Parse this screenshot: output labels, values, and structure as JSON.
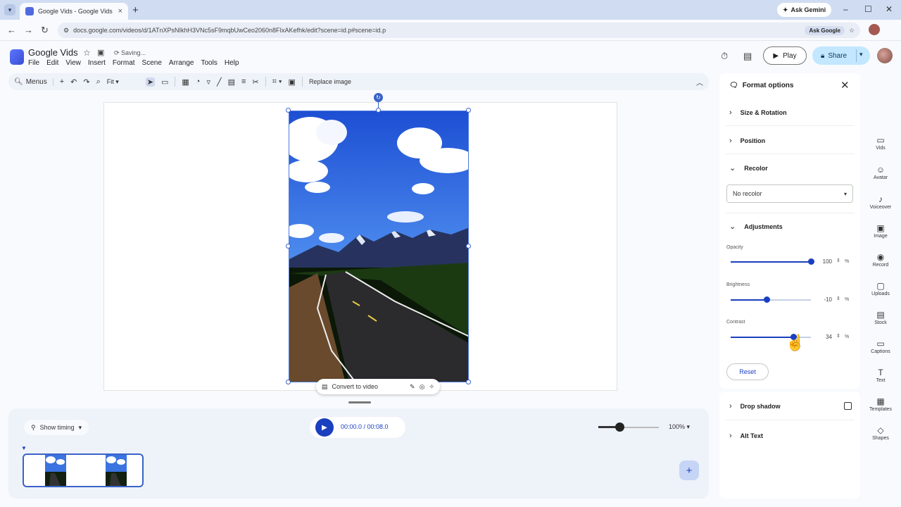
{
  "browser": {
    "tab_title": "Google Vids - Google Vids",
    "url": "docs.google.com/videos/d/1ATnXPsNIkhH3VNc5sF9mqbUwCeo2060n8FIxAKefhk/edit?scene=id.p#scene=id.p",
    "ask_gemini": "Ask Gemini",
    "ask_google": "Ask Google"
  },
  "app": {
    "title": "Google Vids",
    "status": "Saving...",
    "menu": [
      "File",
      "Edit",
      "View",
      "Insert",
      "Format",
      "Scene",
      "Arrange",
      "Tools",
      "Help"
    ],
    "play_label": "Play",
    "share_label": "Share"
  },
  "toolbar": {
    "menus_label": "Menus",
    "zoom_value": "Fit",
    "replace_image": "Replace image"
  },
  "canvas": {
    "convert_to_video": "Convert to video"
  },
  "timeline": {
    "show_timing": "Show timing",
    "time": "00:00.0 / 00:08.0",
    "zoom_pct": "100%",
    "zoom_level": 0.35
  },
  "format_panel": {
    "title": "Format options",
    "sections": {
      "size_rotation": "Size & Rotation",
      "position": "Position",
      "recolor": "Recolor",
      "adjustments": "Adjustments",
      "drop_shadow": "Drop shadow",
      "alt_text": "Alt Text"
    },
    "recolor_value": "No recolor",
    "opacity": {
      "label": "Opacity",
      "value": "100",
      "unit": "%",
      "fraction": 1.0
    },
    "brightness": {
      "label": "Brightness",
      "value": "-10",
      "unit": "%",
      "fraction": 0.45
    },
    "contrast": {
      "label": "Contrast",
      "value": "34",
      "unit": "%",
      "fraction": 0.78
    },
    "reset_label": "Reset"
  },
  "rail": [
    {
      "icon": "vids-icon",
      "label": "Vids"
    },
    {
      "icon": "avatar-icon",
      "label": "Avatar"
    },
    {
      "icon": "voiceover-icon",
      "label": "Voiceover"
    },
    {
      "icon": "image-icon",
      "label": "Image"
    },
    {
      "icon": "record-icon",
      "label": "Record"
    },
    {
      "icon": "uploads-icon",
      "label": "Uploads"
    },
    {
      "icon": "stock-icon",
      "label": "Stock"
    },
    {
      "icon": "captions-icon",
      "label": "Captions"
    },
    {
      "icon": "text-icon",
      "label": "Text"
    },
    {
      "icon": "templates-icon",
      "label": "Templates"
    },
    {
      "icon": "shapes-icon",
      "label": "Shapes"
    }
  ],
  "colors": {
    "accent": "#1a3fbf",
    "selection": "#3a63c8",
    "share_bg": "#c2e7ff"
  }
}
